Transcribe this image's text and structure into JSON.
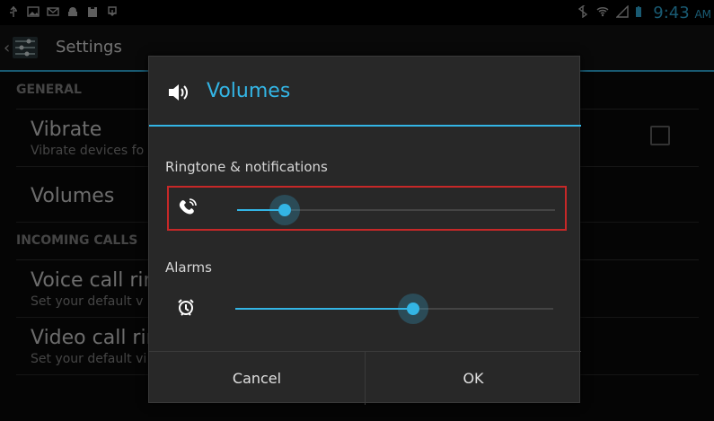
{
  "status_bar": {
    "time": "9:43",
    "ampm": "AM",
    "left_icons": [
      "usb-icon",
      "gallery-icon",
      "mail-icon",
      "android-icon",
      "clipboard-icon",
      "download-icon"
    ],
    "right_icons": [
      "bluetooth-icon",
      "wifi-icon",
      "signal-icon",
      "battery-icon"
    ],
    "accent": "#33b5e5"
  },
  "action_bar": {
    "title": "Settings",
    "back_icon": "chevron-left-icon",
    "app_icon": "settings-app-icon"
  },
  "settings_list": {
    "sections": [
      {
        "header": "GENERAL"
      },
      {
        "header": "INCOMING CALLS"
      }
    ],
    "items": [
      {
        "title": "Vibrate",
        "subtitle": "Vibrate devices fo",
        "checked": false
      },
      {
        "title": "Volumes",
        "subtitle": ""
      },
      {
        "title": "Voice call ring",
        "subtitle": "Set your default v"
      },
      {
        "title": "Video call ring",
        "subtitle": "Set your default vi"
      }
    ]
  },
  "dialog": {
    "title": "Volumes",
    "title_icon": "speaker-icon",
    "sliders": [
      {
        "label": "Ringtone & notifications",
        "icon": "ringtone-icon",
        "level": 0.15,
        "focused": true
      },
      {
        "label": "Alarms",
        "icon": "alarm-clock-icon",
        "level": 0.56,
        "focused": false
      }
    ],
    "buttons": {
      "cancel": "Cancel",
      "ok": "OK"
    }
  }
}
